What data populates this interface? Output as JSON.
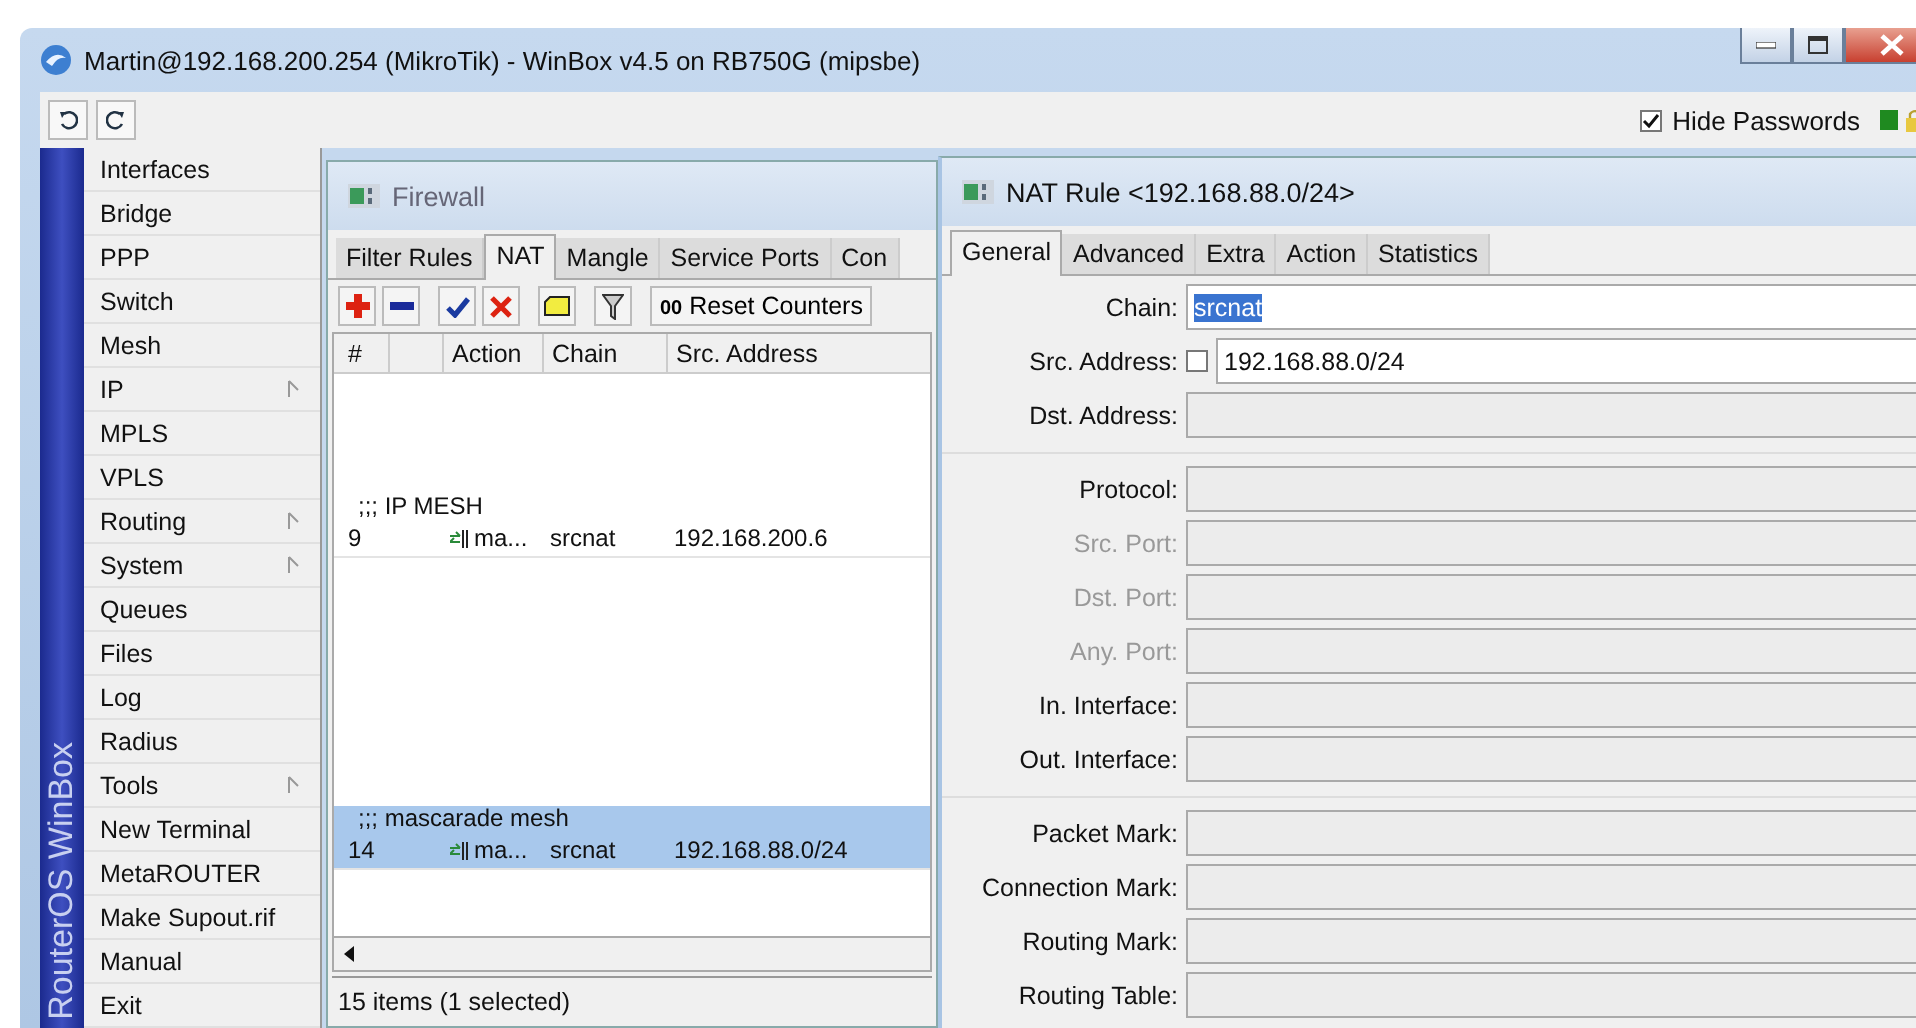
{
  "window": {
    "title": "Martin@192.168.200.254 (MikroTik) - WinBox v4.5 on RB750G (mipsbe)"
  },
  "toolbar": {
    "hide_passwords": {
      "label": "Hide Passwords",
      "checked": true
    }
  },
  "sidebar": {
    "brand": "RouterOS WinBox",
    "items": [
      {
        "label": "Interfaces",
        "submenu": false
      },
      {
        "label": "Bridge",
        "submenu": false
      },
      {
        "label": "PPP",
        "submenu": false
      },
      {
        "label": "Switch",
        "submenu": false
      },
      {
        "label": "Mesh",
        "submenu": false
      },
      {
        "label": "IP",
        "submenu": true
      },
      {
        "label": "MPLS",
        "submenu": false
      },
      {
        "label": "VPLS",
        "submenu": false
      },
      {
        "label": "Routing",
        "submenu": true
      },
      {
        "label": "System",
        "submenu": true
      },
      {
        "label": "Queues",
        "submenu": false
      },
      {
        "label": "Files",
        "submenu": false
      },
      {
        "label": "Log",
        "submenu": false
      },
      {
        "label": "Radius",
        "submenu": false
      },
      {
        "label": "Tools",
        "submenu": true
      },
      {
        "label": "New Terminal",
        "submenu": false
      },
      {
        "label": "MetaROUTER",
        "submenu": false
      },
      {
        "label": "Make Supout.rif",
        "submenu": false
      },
      {
        "label": "Manual",
        "submenu": false
      },
      {
        "label": "Exit",
        "submenu": false
      }
    ]
  },
  "firewall": {
    "title": "Firewall",
    "tabs": [
      {
        "label": "Filter Rules",
        "selected": false
      },
      {
        "label": "NAT",
        "selected": true
      },
      {
        "label": "Mangle",
        "selected": false
      },
      {
        "label": "Service Ports",
        "selected": false
      },
      {
        "label": "Con",
        "selected": false
      }
    ],
    "reset_button": {
      "icon_text": "00",
      "label": "Reset Counters"
    },
    "columns": [
      "#",
      "Action",
      "Chain",
      "Src. Address"
    ],
    "rows": [
      {
        "comment": ";;; IP MESH",
        "number": "9",
        "action": "ma...",
        "chain": "srcnat",
        "src_address": "192.168.200.6",
        "selected": false
      },
      {
        "comment": ";;; mascarade mesh",
        "number": "14",
        "action": "ma...",
        "chain": "srcnat",
        "src_address": "192.168.88.0/24",
        "selected": true
      }
    ],
    "status": "15 items (1 selected)"
  },
  "nat_rule": {
    "title": "NAT Rule <192.168.88.0/24>",
    "tabs": [
      {
        "label": "General",
        "selected": true
      },
      {
        "label": "Advanced",
        "selected": false
      },
      {
        "label": "Extra",
        "selected": false
      },
      {
        "label": "Action",
        "selected": false
      },
      {
        "label": "Statistics",
        "selected": false
      }
    ],
    "sections": [
      [
        {
          "label": "Chain:",
          "value": "srcnat",
          "focused": true,
          "disabled": false
        },
        {
          "label": "Src. Address:",
          "value": "192.168.88.0/24",
          "negate": {
            "checked": false
          },
          "focused": false,
          "disabled": false
        },
        {
          "label": "Dst. Address:",
          "focused": false,
          "disabled": false
        }
      ],
      [
        {
          "label": "Protocol:",
          "focused": false,
          "disabled": false
        },
        {
          "label": "Src. Port:",
          "focused": false,
          "disabled": true
        },
        {
          "label": "Dst. Port:",
          "focused": false,
          "disabled": true
        },
        {
          "label": "Any. Port:",
          "focused": false,
          "disabled": true
        },
        {
          "label": "In. Interface:",
          "focused": false,
          "disabled": false
        },
        {
          "label": "Out. Interface:",
          "focused": false,
          "disabled": false
        }
      ],
      [
        {
          "label": "Packet Mark:",
          "focused": false,
          "disabled": false
        },
        {
          "label": "Connection Mark:",
          "focused": false,
          "disabled": false
        },
        {
          "label": "Routing Mark:",
          "focused": false,
          "disabled": false
        },
        {
          "label": "Routing Table:",
          "focused": false,
          "disabled": false
        }
      ]
    ]
  }
}
